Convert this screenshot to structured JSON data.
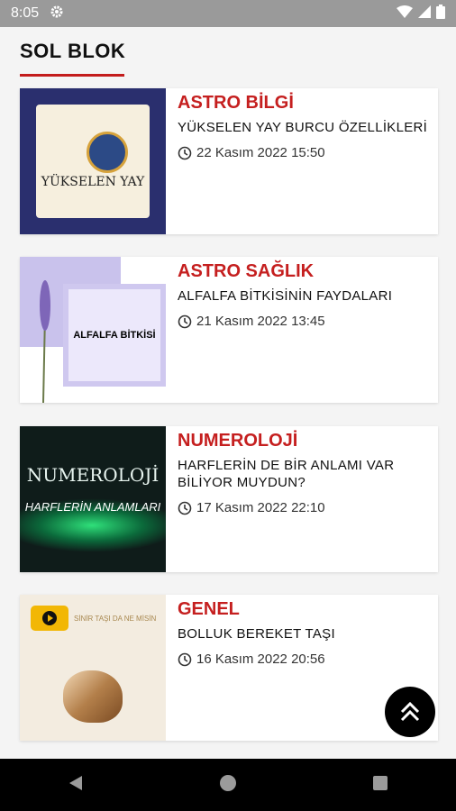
{
  "status_bar": {
    "time": "8:05"
  },
  "header": {
    "title": "SOL BLOK"
  },
  "cards": [
    {
      "category": "ASTRO BİLGİ",
      "title": "YÜKSELEN YAY BURCU ÖZELLİKLERİ",
      "date": "22 Kasım 2022 15:50",
      "thumb_text": "YÜKSELEN YAY"
    },
    {
      "category": "ASTRO SAĞLIK",
      "title": "ALFALFA BİTKİSİNİN FAYDALARI",
      "date": "21 Kasım 2022 13:45",
      "thumb_text": "ALFALFA BİTKİSİ"
    },
    {
      "category": "NUMEROLOJİ",
      "title": "HARFLERİN DE BİR ANLAMI VAR BİLİYOR MUYDUN?",
      "date": "17 Kasım 2022 22:10",
      "thumb_text": "NUMEROLOJİ",
      "thumb_sub": "HARFLERİN ANLAMLARI"
    },
    {
      "category": "GENEL",
      "title": "BOLLUK BEREKET TAŞI",
      "date": "16 Kasım 2022 20:56",
      "thumb_text": "SİNİR TAŞI DA NE MİSİN"
    }
  ],
  "colors": {
    "accent": "#c51f1f",
    "status_bar": "#9a9a9a",
    "nav_bar": "#000000"
  }
}
